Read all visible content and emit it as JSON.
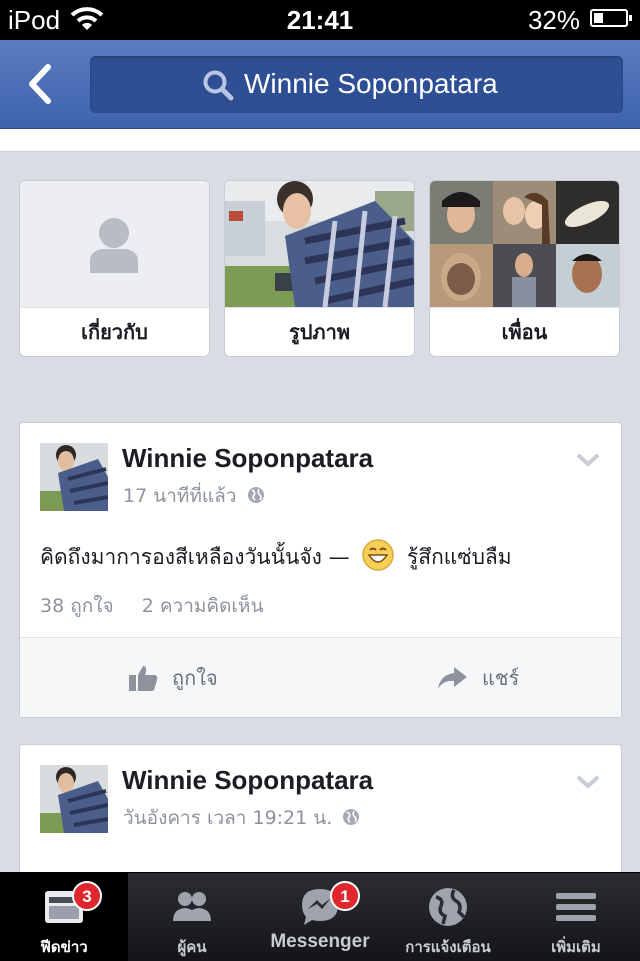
{
  "status_bar": {
    "carrier": "iPod",
    "time": "21:41",
    "battery": "32%"
  },
  "nav": {
    "search_query": "Winnie Soponpatara"
  },
  "profile_tiles": [
    {
      "label": "เกี่ยวกับ"
    },
    {
      "label": "รูปภาพ"
    },
    {
      "label": "เพื่อน"
    }
  ],
  "posts": [
    {
      "author": "Winnie Soponpatara",
      "time": "17 นาทีที่แล้ว",
      "text_before": "คิดถึงมาการองสีเหลืองวันนั้นจัง —",
      "feeling": "รู้สึกแซ่บลืม",
      "likes": "38 ถูกใจ",
      "comments": "2 ความคิดเห็น",
      "like_label": "ถูกใจ",
      "share_label": "แชร์"
    },
    {
      "author": "Winnie Soponpatara",
      "time": "วันอังคาร เวลา 19:21 น."
    }
  ],
  "tab_bar": {
    "tabs": [
      {
        "label": "ฟีดข่าว",
        "badge": "3",
        "icon": "news-feed-icon"
      },
      {
        "label": "ผู้คน",
        "icon": "friends-icon"
      },
      {
        "label": "Messenger",
        "badge": "1",
        "icon": "messenger-icon"
      },
      {
        "label": "การแจ้งเตือน",
        "icon": "globe-icon"
      },
      {
        "label": "เพิ่มเติม",
        "icon": "menu-icon"
      }
    ]
  },
  "colors": {
    "brand_blue": "#3e62ad",
    "badge_red": "#e0272e",
    "background": "#d9dce3"
  }
}
